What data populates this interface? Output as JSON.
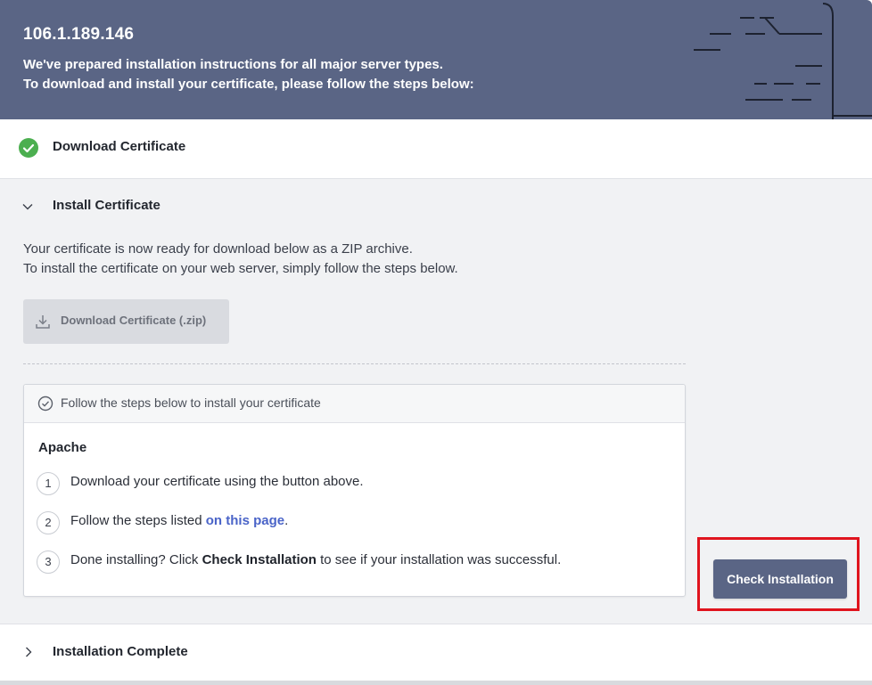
{
  "header": {
    "title": "106.1.189.146",
    "line1": "We've prepared installation instructions for all major server types.",
    "line2": "To download and install your certificate, please follow the steps below:"
  },
  "sections": {
    "download": {
      "label": "Download Certificate",
      "status": "completed",
      "icon": "check-circle-icon"
    },
    "install": {
      "label": "Install Certificate",
      "expanded": true,
      "icon": "chevron-down-icon",
      "intro_line1": "Your certificate is now ready for download below as a ZIP archive.",
      "intro_line2": "To install the certificate on your web server, simply follow the steps below.",
      "download_button": {
        "label": "Download Certificate (.zip)",
        "icon": "download-icon",
        "state": "disabled"
      },
      "steps_card": {
        "header": "Follow the steps below to install your certificate",
        "header_icon": "check-circle-outline-icon",
        "server": "Apache",
        "steps": [
          {
            "number": "1",
            "text": "Download your certificate using the button above."
          },
          {
            "number": "2",
            "text_before": "Follow the steps listed ",
            "link": "on this page",
            "text_after": "."
          },
          {
            "number": "3",
            "text_before": "Done installing? Click ",
            "bold": "Check Installation",
            "text_after": " to see if your installation was successful."
          }
        ]
      },
      "check_button": {
        "label": "Check Installation"
      }
    },
    "complete": {
      "label": "Installation Complete",
      "expanded": false,
      "icon": "chevron-right-icon"
    }
  },
  "colors": {
    "banner": "#5a6585",
    "accent_button": "#5a6585",
    "success": "#4caf50",
    "link": "#4a64c8",
    "highlight": "#e0141e"
  }
}
